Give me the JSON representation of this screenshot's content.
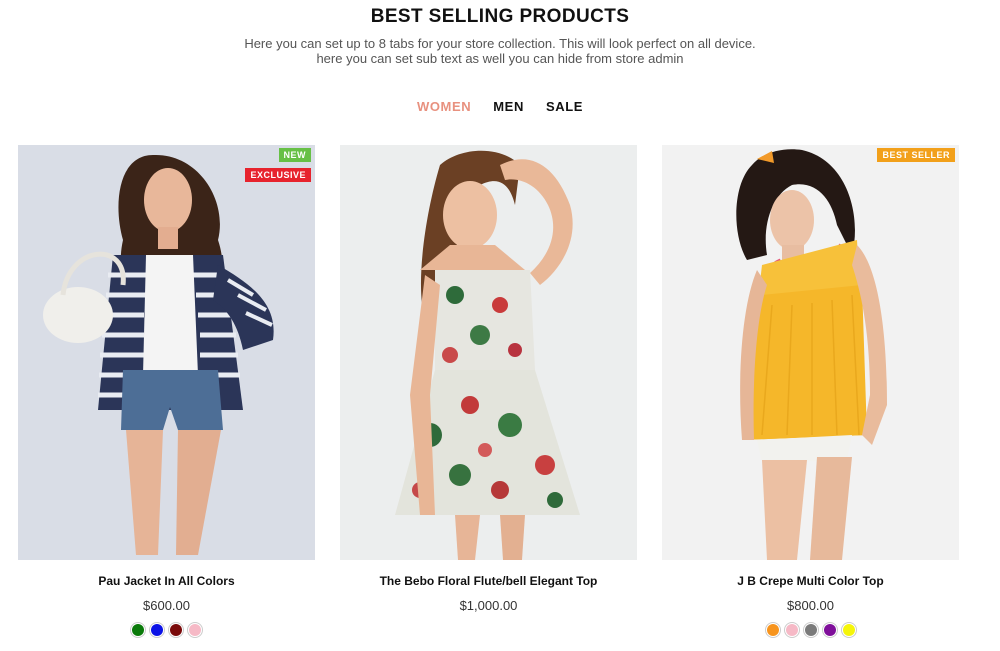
{
  "section": {
    "title": "BEST SELLING PRODUCTS",
    "subtitle_line1": "Here you can set up to 8 tabs for your store collection. This will look perfect on all device.",
    "subtitle_line2": "here you can set sub text as well you can hide from store admin"
  },
  "tabs": [
    {
      "label": "WOMEN",
      "active": true
    },
    {
      "label": "MEN",
      "active": false
    },
    {
      "label": "SALE",
      "active": false
    }
  ],
  "accent_color": "#e8917f",
  "products": [
    {
      "name": "Pau Jacket In All Colors",
      "price": "$600.00",
      "badges": [
        "NEW",
        "EXCLUSIVE"
      ],
      "image_icon": "woman-striped-cardigan-photo",
      "swatches": [
        "#0a7a0a",
        "#0b12e6",
        "#7a0a0a",
        "#f6b9c6"
      ]
    },
    {
      "name": "The Bebo Floral Flute/bell Elegant Top",
      "price": "$1,000.00",
      "badges": [],
      "image_icon": "woman-floral-dress-photo",
      "swatches": []
    },
    {
      "name": "J B Crepe Multi Color Top",
      "price": "$800.00",
      "badges": [
        "BEST SELLER"
      ],
      "image_icon": "woman-yellow-top-photo",
      "swatches": [
        "#f7941d",
        "#f6b9c6",
        "#7a7a7a",
        "#7f0f9a",
        "#f5f50a"
      ]
    }
  ],
  "badge_colors": {
    "new": "#67c046",
    "exclusive": "#e7232d",
    "best_seller": "#f2a01a"
  }
}
